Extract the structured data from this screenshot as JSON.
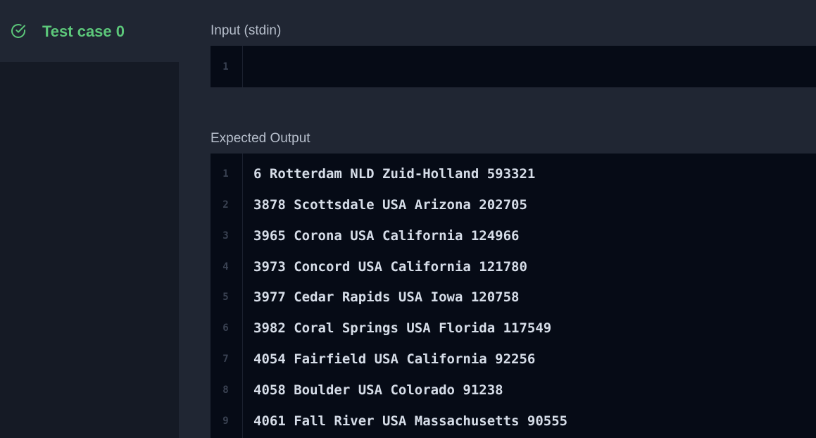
{
  "sidebar": {
    "items": [
      {
        "label": "Test case 0",
        "status_icon": "check-circle-icon",
        "status_color": "#5cc77a"
      }
    ]
  },
  "input": {
    "label": "Input (stdin)",
    "lines": [
      {
        "number": "1",
        "text": ""
      }
    ]
  },
  "expected": {
    "label": "Expected Output",
    "lines": [
      {
        "number": "1",
        "text": "6 Rotterdam NLD Zuid-Holland 593321"
      },
      {
        "number": "2",
        "text": "3878 Scottsdale USA Arizona 202705"
      },
      {
        "number": "3",
        "text": "3965 Corona USA California 124966"
      },
      {
        "number": "4",
        "text": "3973 Concord USA California 121780"
      },
      {
        "number": "5",
        "text": "3977 Cedar Rapids USA Iowa 120758"
      },
      {
        "number": "6",
        "text": "3982 Coral Springs USA Florida 117549"
      },
      {
        "number": "7",
        "text": "4054 Fairfield USA California 92256"
      },
      {
        "number": "8",
        "text": "4058 Boulder USA Colorado 91238"
      },
      {
        "number": "9",
        "text": "4061 Fall River USA Massachusetts 90555"
      }
    ]
  }
}
